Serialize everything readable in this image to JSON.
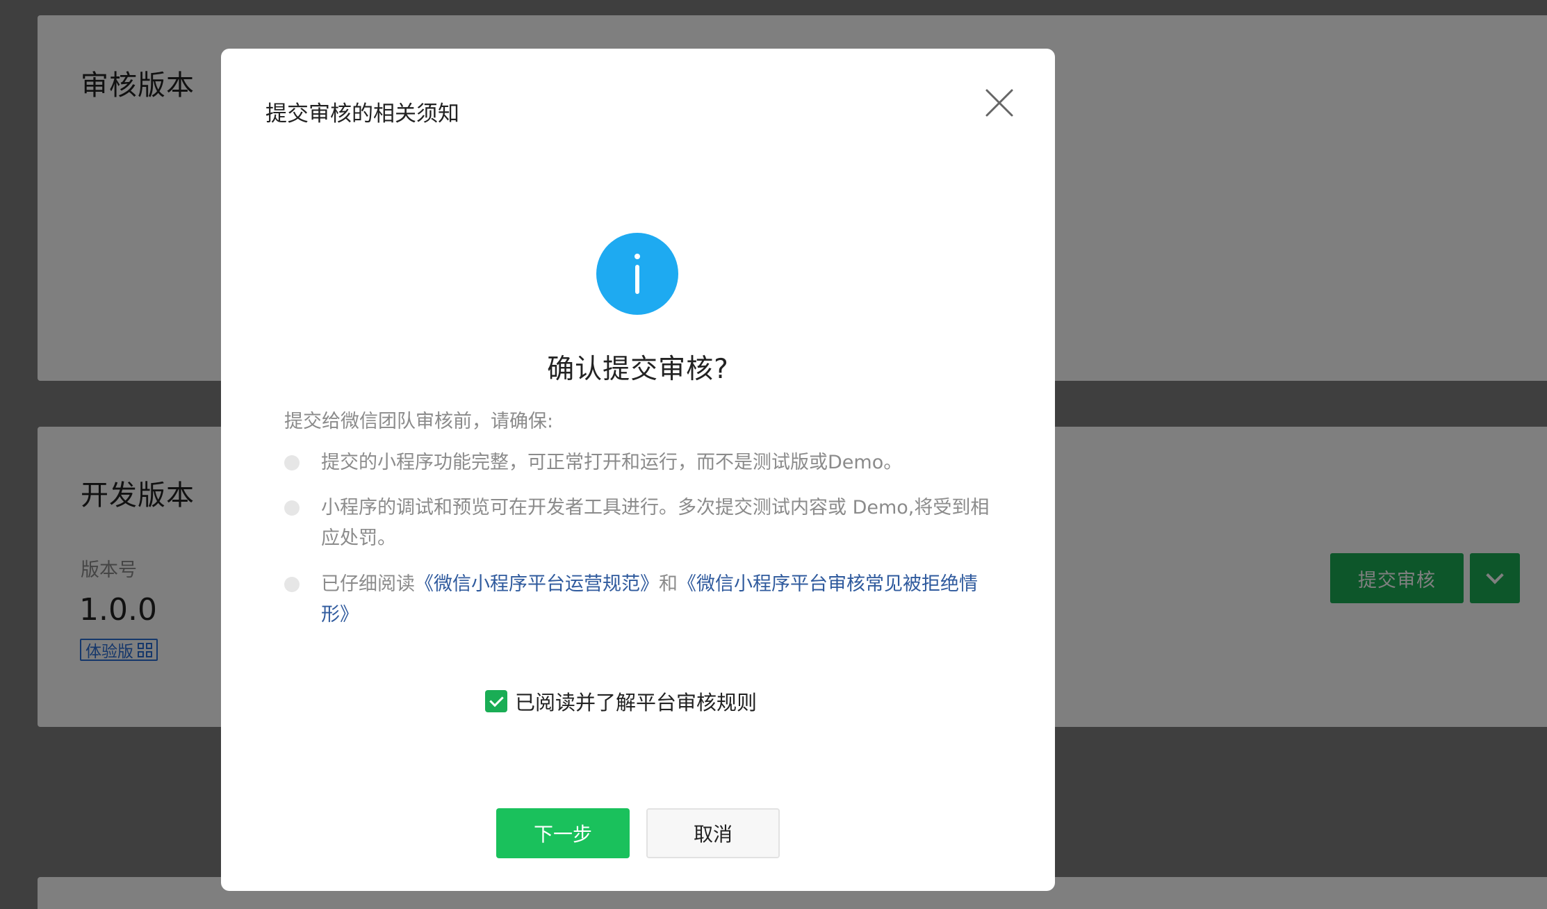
{
  "background": {
    "review_section": {
      "title": "审核版本"
    },
    "dev_section": {
      "title": "开发版本",
      "version_label": "版本号",
      "version_value": "1.0.0",
      "tag_label": "体验版",
      "submit_button": "提交审核"
    },
    "accent_color": "#1aad55",
    "link_color": "#2b6fd6"
  },
  "modal": {
    "title": "提交审核的相关须知",
    "heading": "确认提交审核?",
    "intro": "提交给微信团队审核前，请确保:",
    "items": [
      {
        "text": "提交的小程序功能完整，可正常打开和运行，而不是测试版或Demo。"
      },
      {
        "text": "小程序的调试和预览可在开发者工具进行。多次提交测试内容或 Demo,将受到相应处罚。"
      },
      {
        "prefix": "已仔细阅读",
        "link1": "《微信小程序平台运营规范》",
        "joiner": "和",
        "link2": "《微信小程序平台审核常见被拒绝情形》"
      }
    ],
    "agree": {
      "label": "已阅读并了解平台审核规则",
      "checked": true
    },
    "next_button": "下一步",
    "cancel_button": "取消",
    "info_color": "#1eaaf1",
    "primary_color": "#1ac15c"
  }
}
